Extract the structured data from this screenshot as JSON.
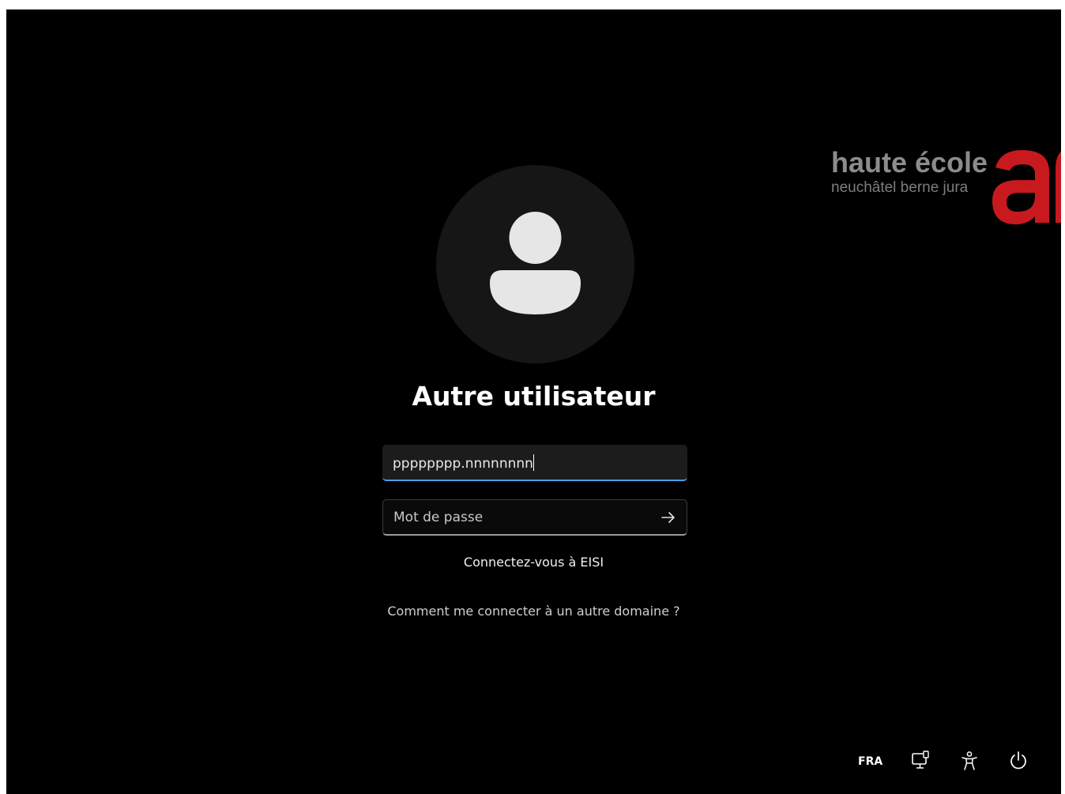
{
  "logo": {
    "line1": "haute école",
    "line2": "neuchâtel berne jura",
    "mark_color": "#c8191f"
  },
  "user": {
    "display_name": "Autre utilisateur",
    "avatar_icon": "user-silhouette-icon"
  },
  "login_form": {
    "username_value": "pppppppp.nnnnnnnn",
    "password_placeholder": "Mot de passe",
    "submit_icon": "arrow-right-icon",
    "accent_color": "#4d9fe8"
  },
  "domain_label": "Connectez-vous à EISI",
  "other_domain_link": "Comment me connecter à un autre domaine ?",
  "system_tray": {
    "language": "FRA",
    "network_icon": "network-icon",
    "accessibility_icon": "accessibility-icon",
    "power_icon": "power-icon"
  }
}
